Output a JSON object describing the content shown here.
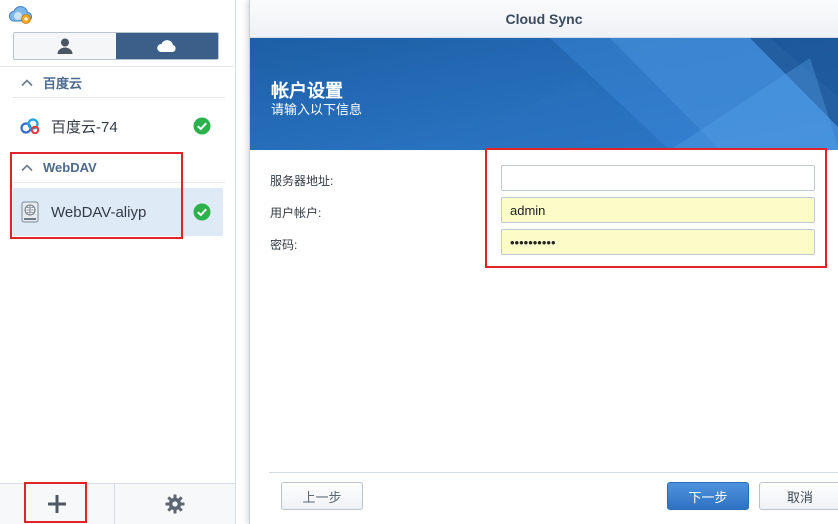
{
  "sidebar": {
    "view_toggle": {
      "selected": "cloud"
    },
    "groups": [
      {
        "title": "百度云",
        "items": [
          {
            "label": "百度云-74",
            "status": "ok"
          }
        ]
      },
      {
        "title": "WebDAV",
        "items": [
          {
            "label": "WebDAV-aliyp",
            "status": "ok",
            "selected": true
          }
        ]
      }
    ],
    "footer": {
      "add": "add-icon",
      "settings": "gear-icon"
    }
  },
  "dialog": {
    "title": "Cloud Sync",
    "banner": {
      "title": "帐户设置",
      "subtitle": "请输入以下信息"
    },
    "form": {
      "server": {
        "label": "服务器地址:",
        "value": ""
      },
      "user": {
        "label": "用户帐户:",
        "value": "admin"
      },
      "password": {
        "label": "密码:",
        "value": "••••••••••"
      }
    },
    "buttons": {
      "prev": "上一步",
      "next": "下一步",
      "cancel": "取消"
    }
  },
  "colors": {
    "accent": "#3c5f8a",
    "banner": "#1b5fa5",
    "highlight": "#e0242a",
    "status_ok": "#2bb24c",
    "autofill": "#fbfcc7"
  }
}
